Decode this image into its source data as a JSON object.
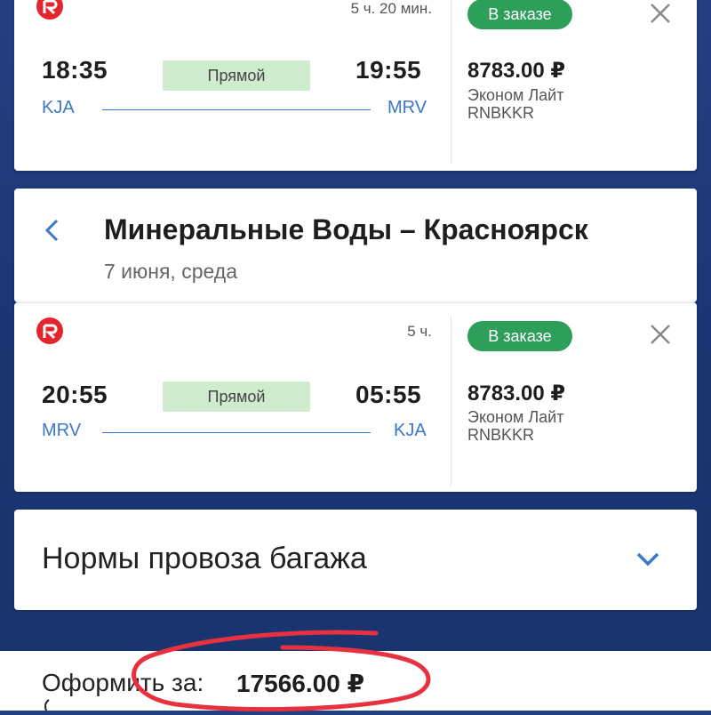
{
  "flights": [
    {
      "duration": "5 ч. 20 мин.",
      "departure_time": "18:35",
      "arrival_time": "19:55",
      "type_label": "Прямой",
      "from_code": "KJA",
      "to_code": "MRV",
      "status": "В заказе",
      "price": "8783.00 ₽",
      "fare_class": "Эконом Лайт",
      "fare_code": "RNBKKR"
    },
    {
      "duration": "5 ч.",
      "departure_time": "20:55",
      "arrival_time": "05:55",
      "type_label": "Прямой",
      "from_code": "MRV",
      "to_code": "KJA",
      "status": "В заказе",
      "price": "8783.00 ₽",
      "fare_class": "Эконом Лайт",
      "fare_code": "RNBKKR"
    }
  ],
  "return_route": {
    "title": "Минеральные Воды – Красноярск",
    "date": "7 июня, среда"
  },
  "baggage": {
    "title": "Нормы провоза багажа"
  },
  "footer": {
    "label": "Оформить за:",
    "total": "17566.00 ₽"
  },
  "colors": {
    "accent": "#3b78c8",
    "status_green": "#2e9e5b",
    "direct_badge": "#cfeccf",
    "airline_red": "#e3262d",
    "annotation_red": "#e8313f",
    "background": "#1c3675"
  },
  "icons": {
    "airline": "airline-logo-icon",
    "close": "close-icon",
    "back": "chevron-left-icon",
    "expand": "chevron-down-icon"
  }
}
